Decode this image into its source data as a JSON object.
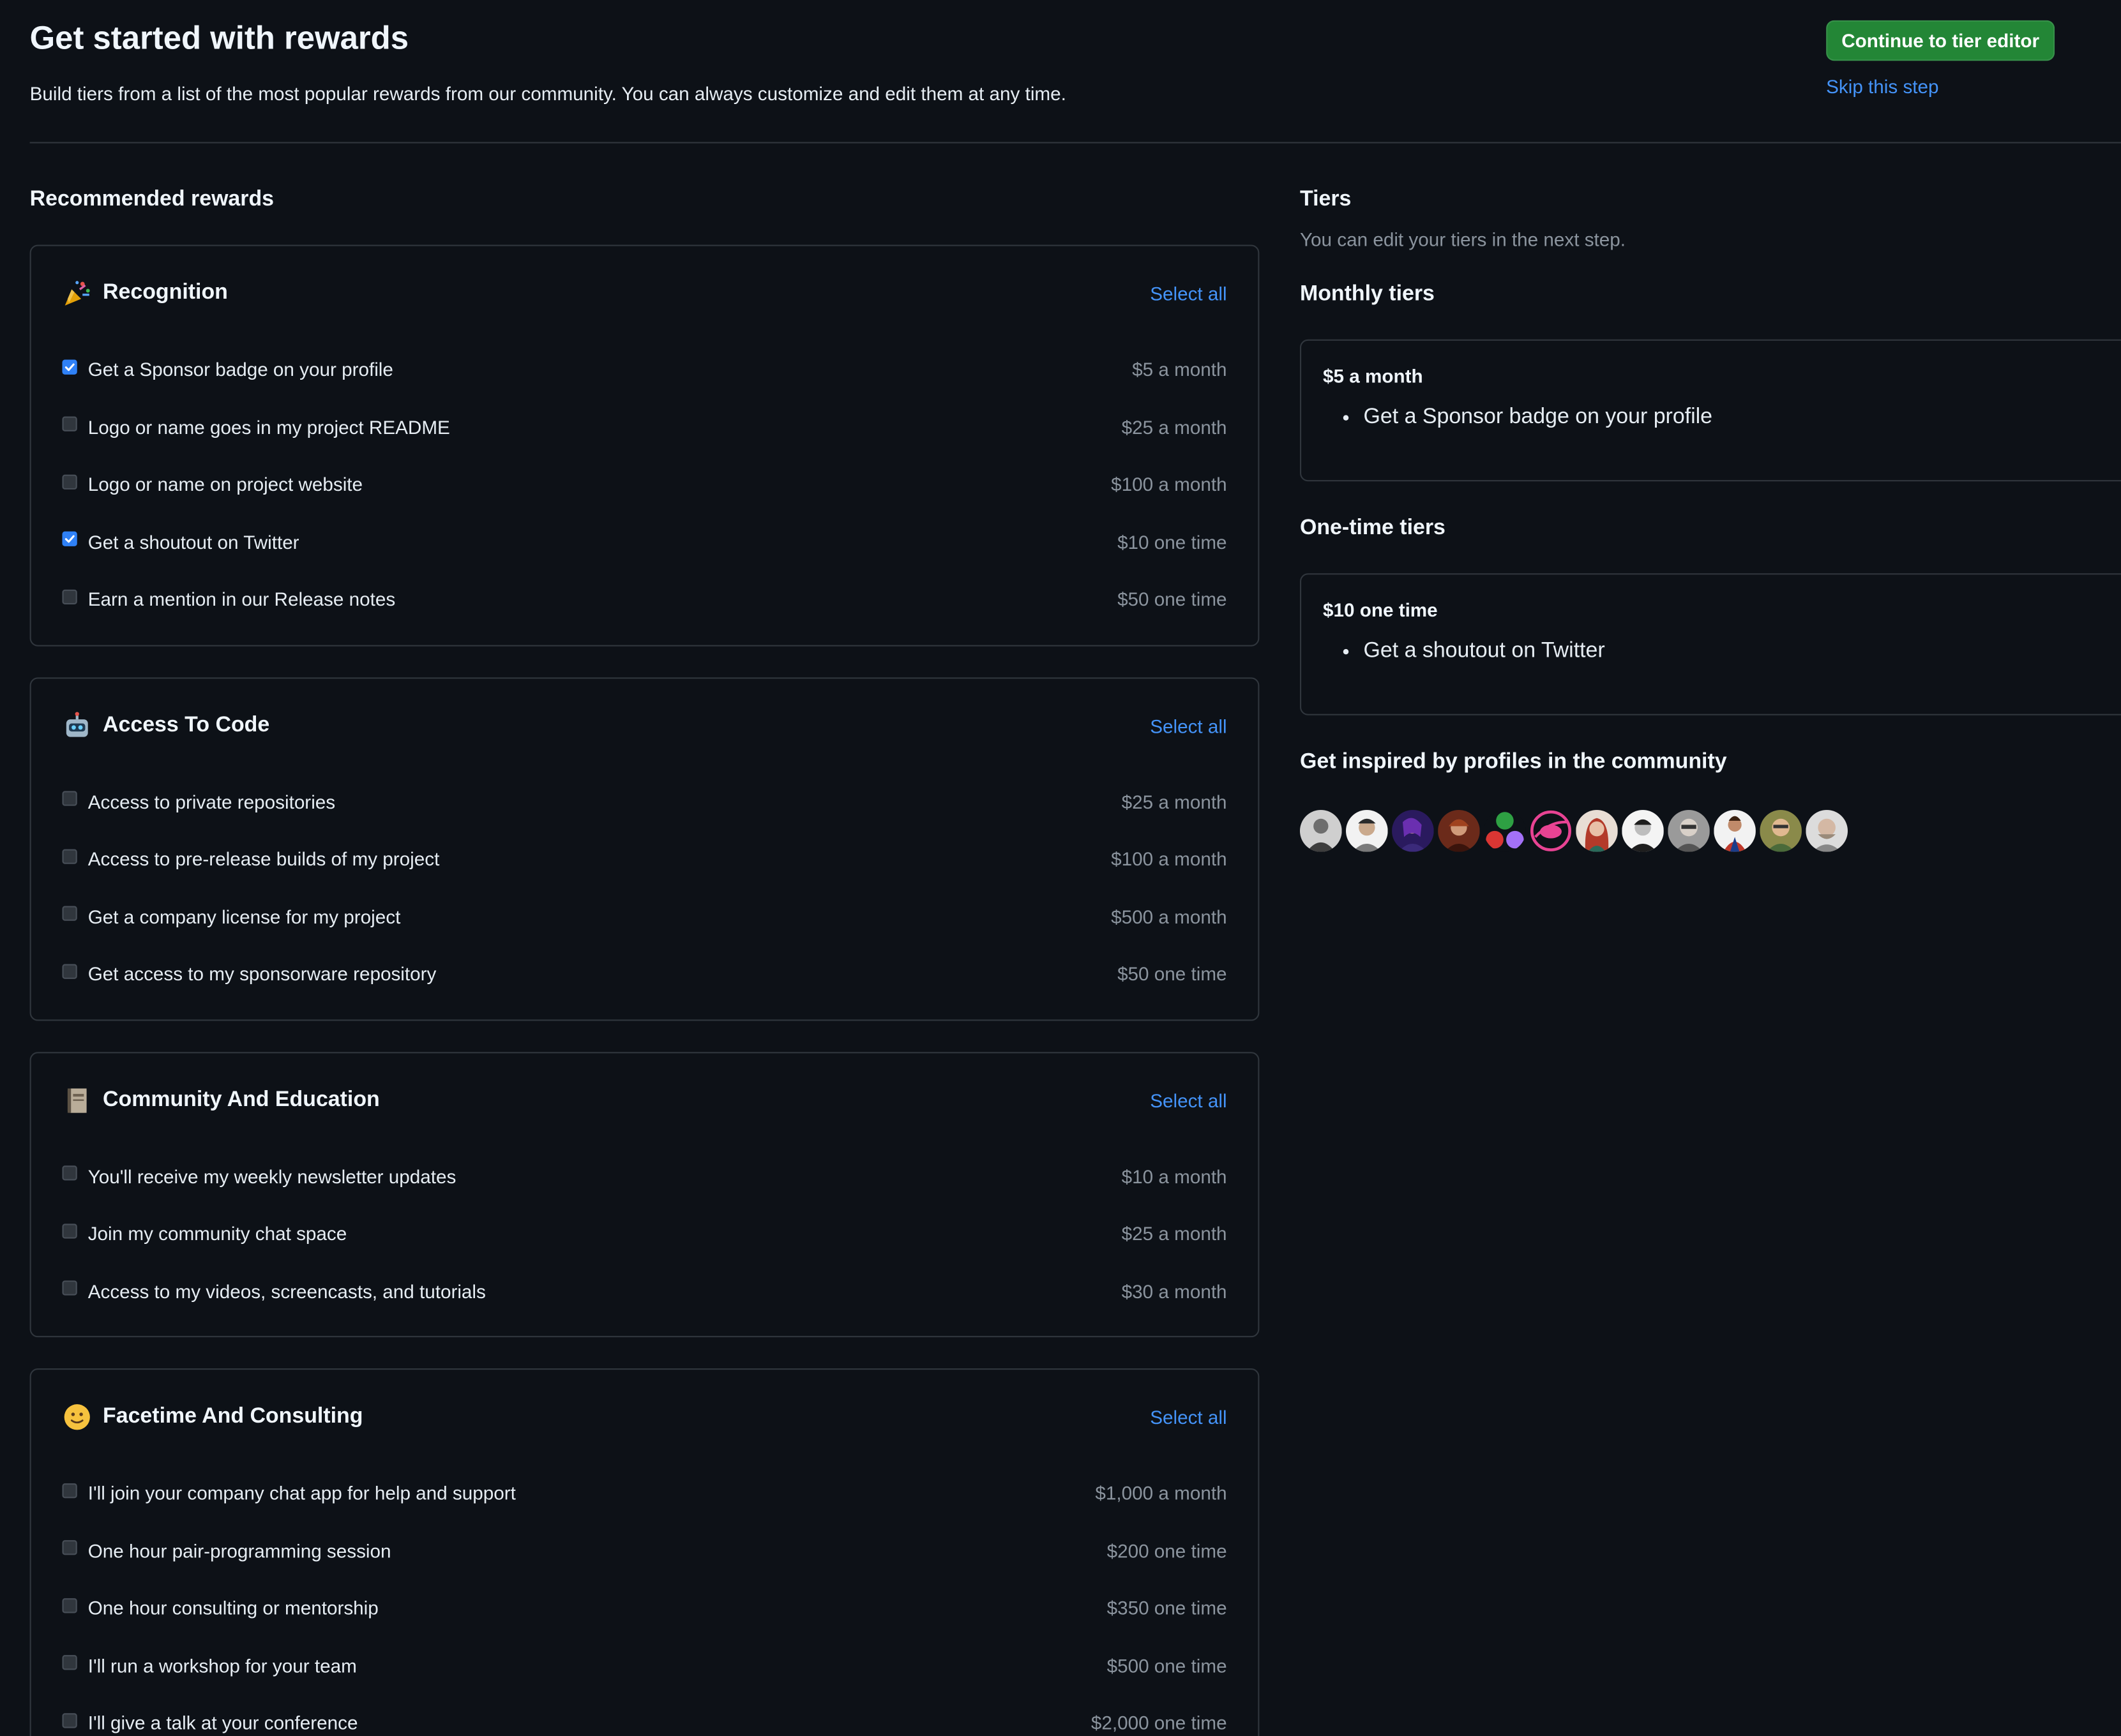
{
  "header": {
    "title": "Get started with rewards",
    "subtitle": "Build tiers from a list of the most popular rewards from our community. You can always customize and edit them at any time.",
    "continue_label": "Continue to tier editor",
    "skip_label": "Skip this step"
  },
  "recommended": {
    "heading": "Recommended rewards",
    "categories": [
      {
        "title": "Recognition",
        "icon": "party-popper-icon",
        "select_all": "Select all",
        "items": [
          {
            "label": "Get a Sponsor badge on your profile",
            "price": "$5 a month",
            "checked": true
          },
          {
            "label": "Logo or name goes in my project README",
            "price": "$25 a month",
            "checked": false
          },
          {
            "label": "Logo or name on project website",
            "price": "$100 a month",
            "checked": false
          },
          {
            "label": "Get a shoutout on Twitter",
            "price": "$10 one time",
            "checked": true
          },
          {
            "label": "Earn a mention in our Release notes",
            "price": "$50 one time",
            "checked": false
          }
        ]
      },
      {
        "title": "Access To Code",
        "icon": "robot-icon",
        "select_all": "Select all",
        "items": [
          {
            "label": "Access to private repositories",
            "price": "$25 a month",
            "checked": false
          },
          {
            "label": "Access to pre-release builds of my project",
            "price": "$100 a month",
            "checked": false
          },
          {
            "label": "Get a company license for my project",
            "price": "$500 a month",
            "checked": false
          },
          {
            "label": "Get access to my sponsorware repository",
            "price": "$50 one time",
            "checked": false
          }
        ]
      },
      {
        "title": "Community And Education",
        "icon": "notebook-icon",
        "select_all": "Select all",
        "items": [
          {
            "label": "You'll receive my weekly newsletter updates",
            "price": "$10 a month",
            "checked": false
          },
          {
            "label": "Join my community chat space",
            "price": "$25 a month",
            "checked": false
          },
          {
            "label": "Access to my videos, screencasts, and tutorials",
            "price": "$30 a month",
            "checked": false
          }
        ]
      },
      {
        "title": "Facetime And Consulting",
        "icon": "smiley-face-icon",
        "select_all": "Select all",
        "items": [
          {
            "label": "I'll join your company chat app for help and support",
            "price": "$1,000 a month",
            "checked": false
          },
          {
            "label": "One hour pair-programming session",
            "price": "$200 one time",
            "checked": false
          },
          {
            "label": "One hour consulting or mentorship",
            "price": "$350 one time",
            "checked": false
          },
          {
            "label": "I'll run a workshop for your team",
            "price": "$500 one time",
            "checked": false
          },
          {
            "label": "I'll give a talk at your conference",
            "price": "$2,000 one time",
            "checked": false
          }
        ]
      }
    ]
  },
  "tiers": {
    "heading": "Tiers",
    "note": "You can edit your tiers in the next step.",
    "monthly_heading": "Monthly tiers",
    "monthly": [
      {
        "price": "$5 a month",
        "rewards": [
          "Get a Sponsor badge on your profile"
        ]
      }
    ],
    "onetime_heading": "One-time tiers",
    "onetime": [
      {
        "price": "$10 one time",
        "rewards": [
          "Get a shoutout on Twitter"
        ]
      }
    ]
  },
  "community": {
    "heading": "Get inspired by profiles in the community",
    "avatars": [
      "avatar-1",
      "avatar-2",
      "avatar-3",
      "avatar-4",
      "avatar-5",
      "avatar-6",
      "avatar-7",
      "avatar-8",
      "avatar-9",
      "avatar-10",
      "avatar-11",
      "avatar-12"
    ]
  },
  "colors": {
    "background": "#0d1117",
    "border": "#30363d",
    "link": "#4493f8",
    "primary_button": "#238636",
    "checkbox_checked": "#2f81f7",
    "muted_text": "#8b949e"
  }
}
